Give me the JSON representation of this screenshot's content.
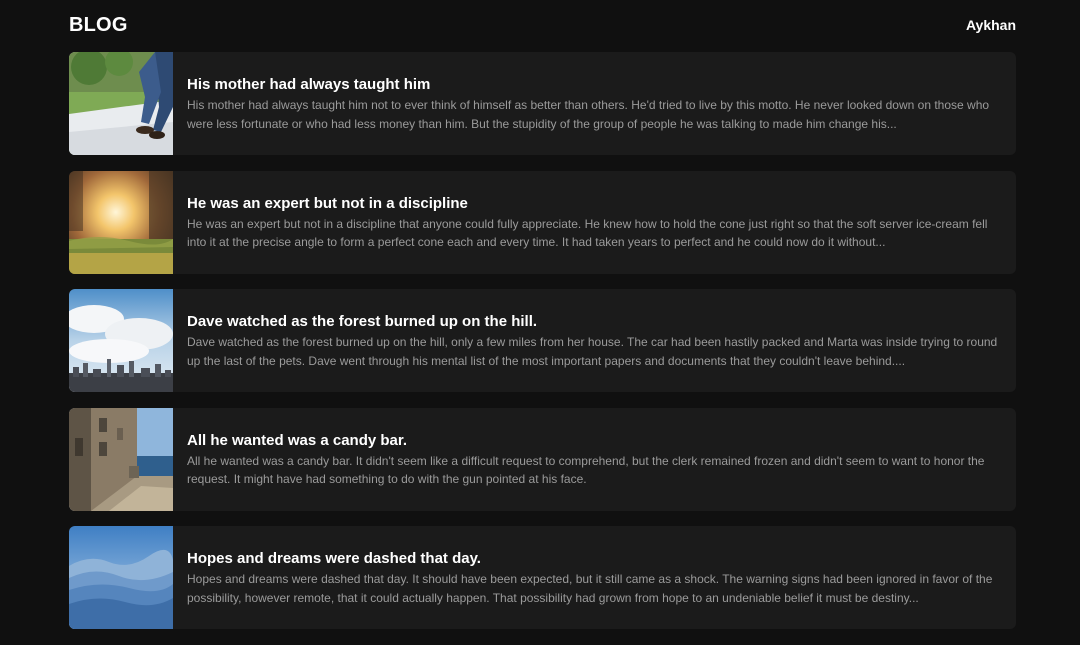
{
  "header": {
    "logo": "BLOG",
    "user": "Aykhan"
  },
  "posts": [
    {
      "title": "His mother had always taught him",
      "excerpt": "His mother had always taught him not to ever think of himself as better than others. He'd tried to live by this motto. He never looked down on those who were less fortunate or who had less money than him. But the stupidity of the group of people he was talking to made him change his...",
      "image": "walking-legs-photo"
    },
    {
      "title": "He was an expert but not in a discipline",
      "excerpt": "He was an expert but not in a discipline that anyone could fully appreciate. He knew how to hold the cone just right so that the soft server ice-cream fell into it at the precise angle to form a perfect cone each and every time. It had taken years to perfect and he could now do it without...",
      "image": "sunset-field-photo"
    },
    {
      "title": "Dave watched as the forest burned up on the hill.",
      "excerpt": "Dave watched as the forest burned up on the hill, only a few miles from her house. The car had been hastily packed and Marta was inside trying to round up the last of the pets. Dave went through his mental list of the most important papers and documents that they couldn't leave behind....",
      "image": "city-skyline-photo"
    },
    {
      "title": "All he wanted was a candy bar.",
      "excerpt": "All he wanted was a candy bar. It didn't seem like a difficult request to comprehend, but the clerk remained frozen and didn't seem to want to honor the request. It might have had something to do with the gun pointed at his face.",
      "image": "seaside-alley-photo"
    },
    {
      "title": "Hopes and dreams were dashed that day.",
      "excerpt": "Hopes and dreams were dashed that day. It should have been expected, but it still came as a shock. The warning signs had been ignored in favor of the possibility, however remote, that it could actually happen. That possibility had grown from hope to an undeniable belief it must be destiny...",
      "image": "blue-mountains-photo"
    }
  ]
}
